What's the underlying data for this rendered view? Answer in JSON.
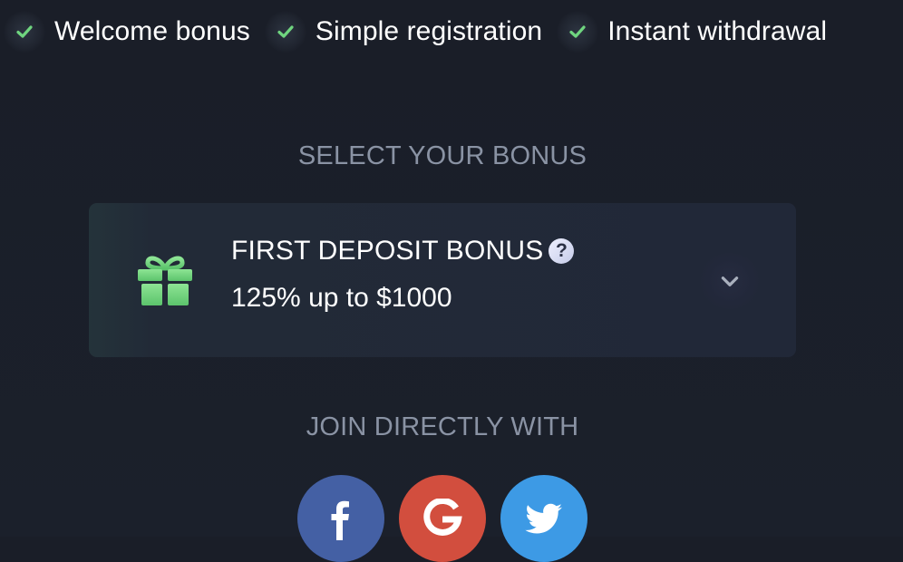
{
  "features": [
    {
      "label": "Welcome bonus",
      "icon": "check-icon"
    },
    {
      "label": "Simple registration",
      "icon": "check-icon"
    },
    {
      "label": "Instant withdrawal",
      "icon": "check-icon"
    }
  ],
  "bonus_section": {
    "heading": "SELECT YOUR BONUS",
    "selected": {
      "title": "FIRST DEPOSIT BONUS",
      "amount": "125% up to $1000",
      "icon": "gift-icon",
      "help_icon": "question-icon",
      "dropdown_icon": "chevron-down-icon"
    }
  },
  "join_section": {
    "heading": "JOIN DIRECTLY WITH",
    "providers": [
      {
        "name": "facebook",
        "color": "#4460a4",
        "icon": "facebook-icon"
      },
      {
        "name": "google",
        "color": "#d24e3e",
        "icon": "google-icon"
      },
      {
        "name": "twitter",
        "color": "#3d9ae5",
        "icon": "twitter-icon"
      }
    ]
  },
  "colors": {
    "background": "#1a1e28",
    "card": "#212838",
    "accent_green": "#6fd57f",
    "muted_text": "#8a93a4",
    "text": "#ffffff"
  }
}
